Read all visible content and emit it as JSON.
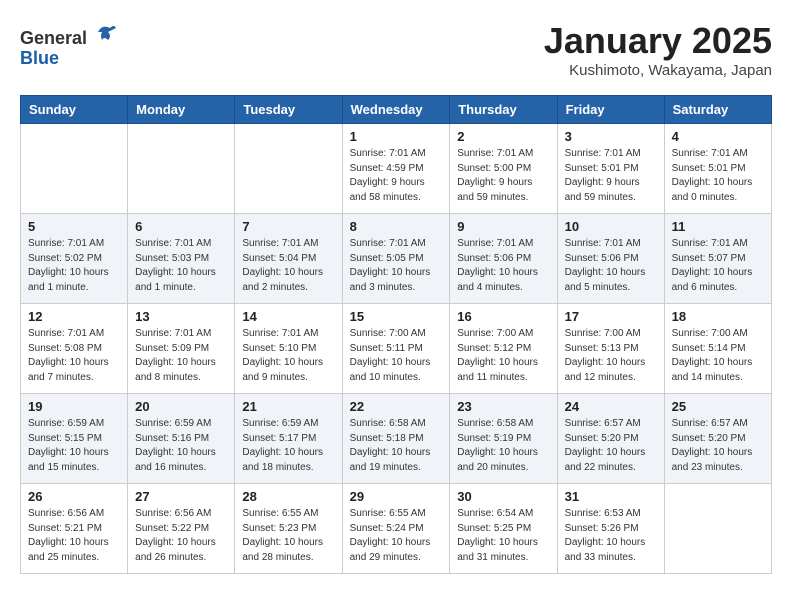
{
  "header": {
    "logo_line1": "General",
    "logo_line2": "Blue",
    "month_title": "January 2025",
    "location": "Kushimoto, Wakayama, Japan"
  },
  "weekdays": [
    "Sunday",
    "Monday",
    "Tuesday",
    "Wednesday",
    "Thursday",
    "Friday",
    "Saturday"
  ],
  "weeks": [
    [
      {
        "day": "",
        "info": ""
      },
      {
        "day": "",
        "info": ""
      },
      {
        "day": "",
        "info": ""
      },
      {
        "day": "1",
        "info": "Sunrise: 7:01 AM\nSunset: 4:59 PM\nDaylight: 9 hours and 58 minutes."
      },
      {
        "day": "2",
        "info": "Sunrise: 7:01 AM\nSunset: 5:00 PM\nDaylight: 9 hours and 59 minutes."
      },
      {
        "day": "3",
        "info": "Sunrise: 7:01 AM\nSunset: 5:01 PM\nDaylight: 9 hours and 59 minutes."
      },
      {
        "day": "4",
        "info": "Sunrise: 7:01 AM\nSunset: 5:01 PM\nDaylight: 10 hours and 0 minutes."
      }
    ],
    [
      {
        "day": "5",
        "info": "Sunrise: 7:01 AM\nSunset: 5:02 PM\nDaylight: 10 hours and 1 minute."
      },
      {
        "day": "6",
        "info": "Sunrise: 7:01 AM\nSunset: 5:03 PM\nDaylight: 10 hours and 1 minute."
      },
      {
        "day": "7",
        "info": "Sunrise: 7:01 AM\nSunset: 5:04 PM\nDaylight: 10 hours and 2 minutes."
      },
      {
        "day": "8",
        "info": "Sunrise: 7:01 AM\nSunset: 5:05 PM\nDaylight: 10 hours and 3 minutes."
      },
      {
        "day": "9",
        "info": "Sunrise: 7:01 AM\nSunset: 5:06 PM\nDaylight: 10 hours and 4 minutes."
      },
      {
        "day": "10",
        "info": "Sunrise: 7:01 AM\nSunset: 5:06 PM\nDaylight: 10 hours and 5 minutes."
      },
      {
        "day": "11",
        "info": "Sunrise: 7:01 AM\nSunset: 5:07 PM\nDaylight: 10 hours and 6 minutes."
      }
    ],
    [
      {
        "day": "12",
        "info": "Sunrise: 7:01 AM\nSunset: 5:08 PM\nDaylight: 10 hours and 7 minutes."
      },
      {
        "day": "13",
        "info": "Sunrise: 7:01 AM\nSunset: 5:09 PM\nDaylight: 10 hours and 8 minutes."
      },
      {
        "day": "14",
        "info": "Sunrise: 7:01 AM\nSunset: 5:10 PM\nDaylight: 10 hours and 9 minutes."
      },
      {
        "day": "15",
        "info": "Sunrise: 7:00 AM\nSunset: 5:11 PM\nDaylight: 10 hours and 10 minutes."
      },
      {
        "day": "16",
        "info": "Sunrise: 7:00 AM\nSunset: 5:12 PM\nDaylight: 10 hours and 11 minutes."
      },
      {
        "day": "17",
        "info": "Sunrise: 7:00 AM\nSunset: 5:13 PM\nDaylight: 10 hours and 12 minutes."
      },
      {
        "day": "18",
        "info": "Sunrise: 7:00 AM\nSunset: 5:14 PM\nDaylight: 10 hours and 14 minutes."
      }
    ],
    [
      {
        "day": "19",
        "info": "Sunrise: 6:59 AM\nSunset: 5:15 PM\nDaylight: 10 hours and 15 minutes."
      },
      {
        "day": "20",
        "info": "Sunrise: 6:59 AM\nSunset: 5:16 PM\nDaylight: 10 hours and 16 minutes."
      },
      {
        "day": "21",
        "info": "Sunrise: 6:59 AM\nSunset: 5:17 PM\nDaylight: 10 hours and 18 minutes."
      },
      {
        "day": "22",
        "info": "Sunrise: 6:58 AM\nSunset: 5:18 PM\nDaylight: 10 hours and 19 minutes."
      },
      {
        "day": "23",
        "info": "Sunrise: 6:58 AM\nSunset: 5:19 PM\nDaylight: 10 hours and 20 minutes."
      },
      {
        "day": "24",
        "info": "Sunrise: 6:57 AM\nSunset: 5:20 PM\nDaylight: 10 hours and 22 minutes."
      },
      {
        "day": "25",
        "info": "Sunrise: 6:57 AM\nSunset: 5:20 PM\nDaylight: 10 hours and 23 minutes."
      }
    ],
    [
      {
        "day": "26",
        "info": "Sunrise: 6:56 AM\nSunset: 5:21 PM\nDaylight: 10 hours and 25 minutes."
      },
      {
        "day": "27",
        "info": "Sunrise: 6:56 AM\nSunset: 5:22 PM\nDaylight: 10 hours and 26 minutes."
      },
      {
        "day": "28",
        "info": "Sunrise: 6:55 AM\nSunset: 5:23 PM\nDaylight: 10 hours and 28 minutes."
      },
      {
        "day": "29",
        "info": "Sunrise: 6:55 AM\nSunset: 5:24 PM\nDaylight: 10 hours and 29 minutes."
      },
      {
        "day": "30",
        "info": "Sunrise: 6:54 AM\nSunset: 5:25 PM\nDaylight: 10 hours and 31 minutes."
      },
      {
        "day": "31",
        "info": "Sunrise: 6:53 AM\nSunset: 5:26 PM\nDaylight: 10 hours and 33 minutes."
      },
      {
        "day": "",
        "info": ""
      }
    ]
  ]
}
